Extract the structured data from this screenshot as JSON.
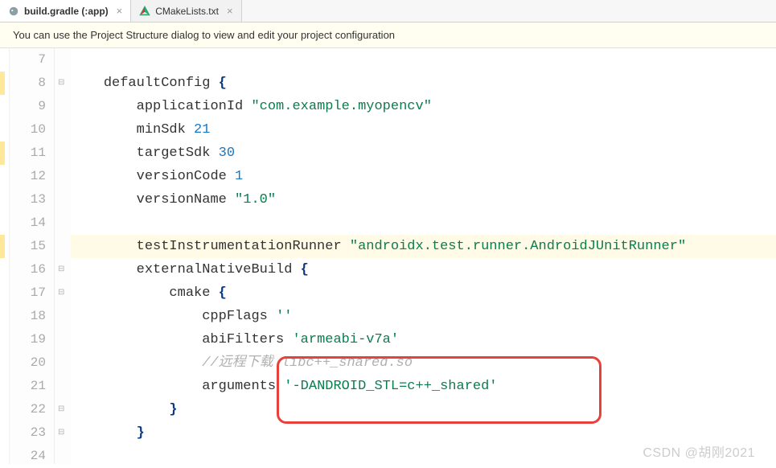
{
  "tabs": [
    {
      "icon": "elephant",
      "label": "build.gradle (:app)",
      "active": true,
      "closable": true
    },
    {
      "icon": "cmake",
      "label": "CMakeLists.txt",
      "active": false,
      "closable": true
    }
  ],
  "hint": "You can use the Project Structure dialog to view and edit your project configuration",
  "gutter_start": 7,
  "gutter_end": 24,
  "caret_line": 15,
  "fold_markers": [
    8,
    16,
    17,
    22,
    23
  ],
  "code": {
    "l7": "",
    "l8_ident": "defaultConfig",
    "l8_brace": " {",
    "l9_ident": "applicationId",
    "l9_str": "\"com.example.myopencv\"",
    "l10_ident": "minSdk",
    "l10_num": "21",
    "l11_ident": "targetSdk",
    "l11_num": "30",
    "l12_ident": "versionCode",
    "l12_num": "1",
    "l13_ident": "versionName",
    "l13_str": "\"1.0\"",
    "l15_ident": "testInstrumentationRunner",
    "l15_str": "\"androidx.test.runner.AndroidJUnitRunner\"",
    "l16_ident": "externalNativeBuild",
    "l16_brace": " {",
    "l17_ident": "cmake",
    "l17_brace": " {",
    "l18_ident": "cppFlags",
    "l18_str": "''",
    "l19_ident": "abiFilters",
    "l19_str": "'armeabi-v7a'",
    "l20_comment": "//远程下载 libc++_shared.so",
    "l21_ident": "arguments",
    "l21_str": "'-DANDROID_STL=c++_shared'",
    "l22_brace": "}",
    "l23_brace": "}"
  },
  "watermark": "CSDN @胡刚2021"
}
